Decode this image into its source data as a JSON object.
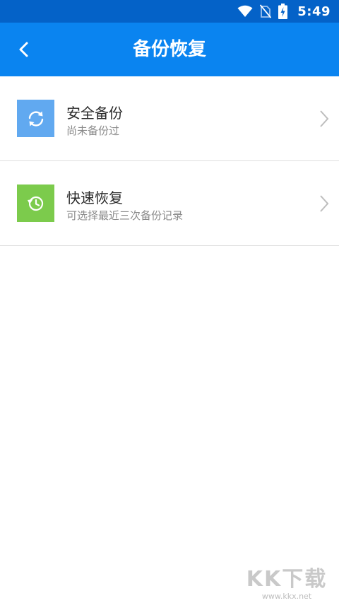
{
  "status_bar": {
    "time": "5:49",
    "icons": [
      "wifi-icon",
      "no-sim-icon",
      "battery-charging-icon"
    ]
  },
  "header": {
    "title": "备份恢复",
    "back_icon": "back-arrow-icon"
  },
  "items": [
    {
      "title": "安全备份",
      "subtitle": "尚未备份过",
      "icon": "sync-icon",
      "icon_bg": "#61a9f0"
    },
    {
      "title": "快速恢复",
      "subtitle": "可选择最近三次备份记录",
      "icon": "history-icon",
      "icon_bg": "#7ccb4c"
    }
  ],
  "watermark": {
    "logo": "KK下载",
    "url": "www.kkx.net"
  },
  "colors": {
    "status_bar": "#0462c8",
    "app_bar": "#0a84f0"
  }
}
